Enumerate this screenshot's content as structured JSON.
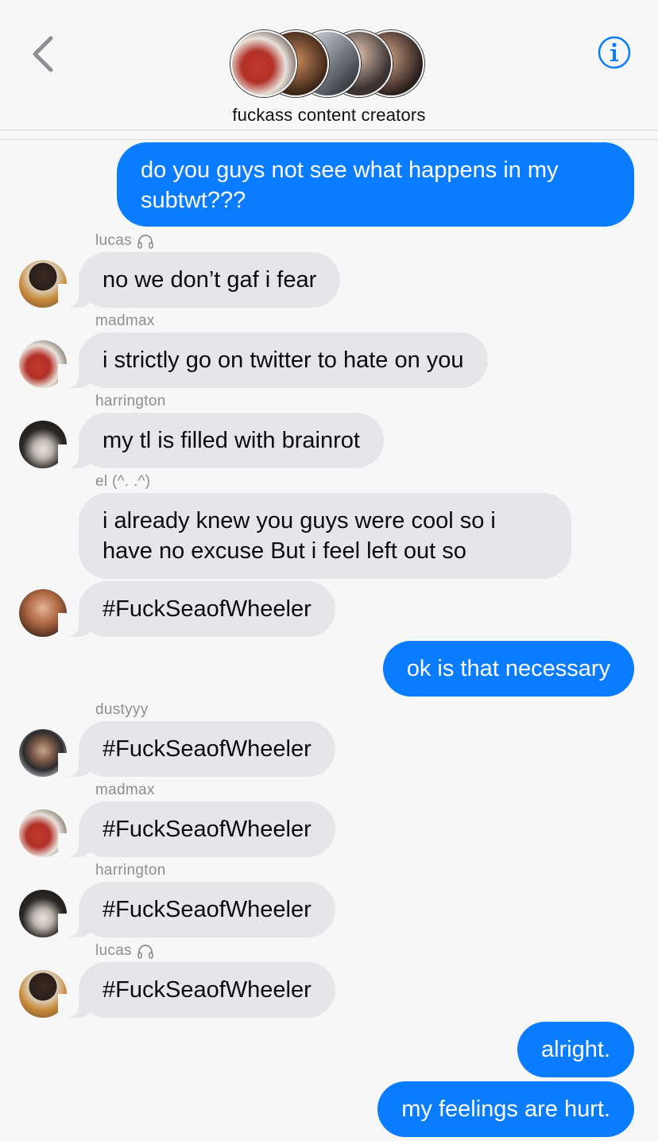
{
  "header": {
    "title": "fuckass content creators",
    "back_icon": "chevron-left-icon",
    "info_icon": "info-icon"
  },
  "colors": {
    "outgoing": "#0a7cff",
    "incoming": "#e6e5ea",
    "accent": "#0a7cff"
  },
  "messages": [
    {
      "dir": "out",
      "text_lines": [
        "do you guys not see what happens in my",
        "subtwt???"
      ]
    },
    {
      "dir": "in",
      "sender": "lucas",
      "sender_icon": "headphones-icon",
      "text": "no we don’t gaf i fear"
    },
    {
      "dir": "in",
      "sender": "madmax",
      "text": "i strictly go on twitter to hate on you"
    },
    {
      "dir": "in",
      "sender": "harrington",
      "text": "my tl is filled with brainrot"
    },
    {
      "dir": "in",
      "sender": "el (^. .^)",
      "text_lines": [
        "i already knew you guys were cool so i",
        "have no excuse But i feel left out so"
      ]
    },
    {
      "dir": "in",
      "text": "#FuckSeaofWheeler"
    },
    {
      "dir": "out",
      "text": "ok is that necessary"
    },
    {
      "dir": "in",
      "sender": "dustyyy",
      "text": "#FuckSeaofWheeler"
    },
    {
      "dir": "in",
      "sender": "madmax",
      "text": "#FuckSeaofWheeler"
    },
    {
      "dir": "in",
      "sender": "harrington",
      "text": "#FuckSeaofWheeler"
    },
    {
      "dir": "in",
      "sender": "lucas",
      "sender_icon": "headphones-icon",
      "text": "#FuckSeaofWheeler"
    },
    {
      "dir": "out",
      "text": "alright."
    },
    {
      "dir": "out",
      "text": "my feelings are hurt."
    }
  ]
}
